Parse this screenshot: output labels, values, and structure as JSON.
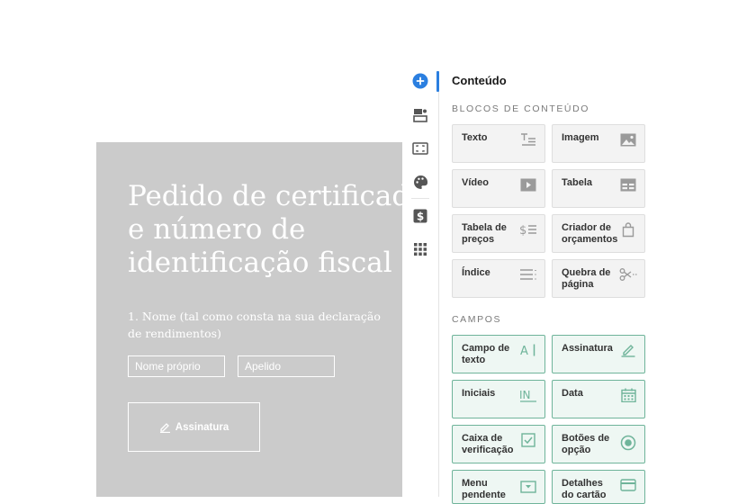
{
  "document": {
    "title": "Pedido de certificado\ne número de\nidentificação fiscal",
    "question": "1. Nome (tal como consta na sua declaração de rendimentos)",
    "first_name_placeholder": "Nome próprio",
    "last_name_placeholder": "Apelido",
    "signature_label": "Assinatura"
  },
  "rail": {
    "icons": [
      "plus-circle-icon",
      "layout-blocks-icon",
      "frame-icon",
      "palette-icon",
      "dollar-icon",
      "apps-grid-icon"
    ],
    "active": "plus-circle-icon",
    "accent": "#2b7fe0"
  },
  "panel": {
    "title": "Conteúdo",
    "content_section_label": "BLOCOS DE CONTEÚDO",
    "fields_section_label": "CAMPOS",
    "content_blocks": [
      {
        "label": "Texto",
        "icon": "text-icon"
      },
      {
        "label": "Imagem",
        "icon": "image-icon"
      },
      {
        "label": "Vídeo",
        "icon": "video-icon"
      },
      {
        "label": "Tabela",
        "icon": "table-icon"
      },
      {
        "label": "Tabela de preços",
        "icon": "price-table-icon"
      },
      {
        "label": "Criador de orçamentos",
        "icon": "quote-builder-icon"
      },
      {
        "label": "Índice",
        "icon": "toc-icon"
      },
      {
        "label": "Quebra de página",
        "icon": "page-break-icon"
      }
    ],
    "fields": [
      {
        "label": "Campo de texto",
        "icon": "text-field-icon"
      },
      {
        "label": "Assinatura",
        "icon": "signature-icon"
      },
      {
        "label": "Iniciais",
        "icon": "initials-icon"
      },
      {
        "label": "Data",
        "icon": "calendar-icon"
      },
      {
        "label": "Caixa de verificação",
        "icon": "checkbox-icon"
      },
      {
        "label": "Botões de opção",
        "icon": "radio-icon"
      },
      {
        "label": "Menu pendente",
        "icon": "dropdown-icon"
      },
      {
        "label": "Detalhes do cartão",
        "icon": "card-icon"
      }
    ],
    "field_color": "#6fb49a"
  }
}
